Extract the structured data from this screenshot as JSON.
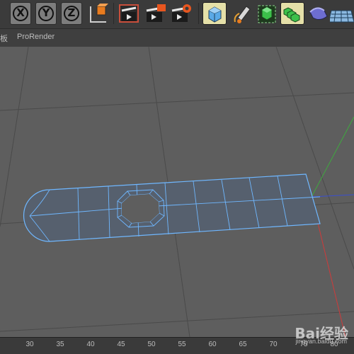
{
  "toolbar": {
    "axes": [
      {
        "letter": "X"
      },
      {
        "letter": "Y"
      },
      {
        "letter": "Z"
      }
    ],
    "icons": [
      "coordinate-system-icon",
      "render-view-icon",
      "render-picture-viewer-icon",
      "render-settings-icon",
      "cube-icon",
      "pen-icon",
      "subdivision-surface-icon",
      "array-icon",
      "deformer-icon",
      "floor-icon"
    ],
    "accent_orange": "#e87b1e",
    "accent_blue": "#4fa3e0"
  },
  "menubar": {
    "items": [
      "板",
      "ProRender"
    ]
  },
  "viewport": {
    "background": "#5e5e5e",
    "mesh_edge_color": "#6fb7ff"
  },
  "timeline": {
    "ticks": [
      "30",
      "35",
      "40",
      "45",
      "50",
      "55",
      "60",
      "65",
      "70",
      "75",
      "80"
    ]
  },
  "watermark": {
    "brand": "Bai经验",
    "url": "jingyan.baidu.com"
  }
}
